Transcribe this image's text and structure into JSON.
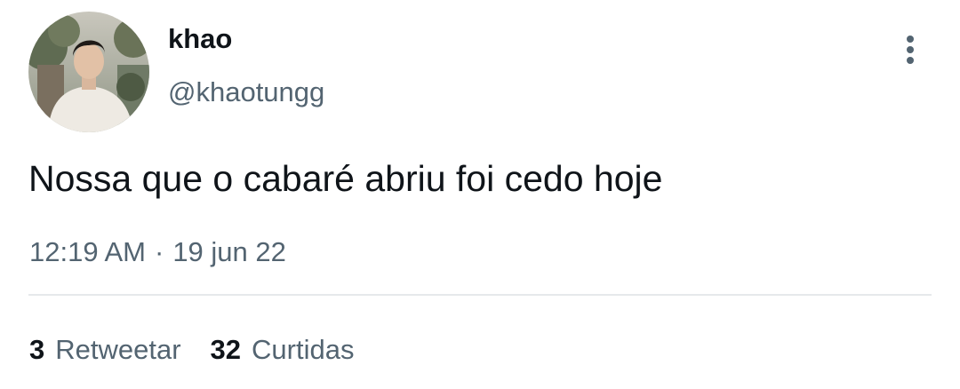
{
  "tweet": {
    "author": {
      "display_name": "khao",
      "handle": "@khaotungg"
    },
    "text": "Nossa que o cabaré abriu foi cedo hoje",
    "time": "12:19 AM",
    "separator": "·",
    "date": "19 jun 22",
    "stats": {
      "retweets_count": "3",
      "retweets_label": "Retweetar",
      "likes_count": "32",
      "likes_label": "Curtidas"
    }
  },
  "icons": {
    "more": "more-vertical-icon"
  },
  "colors": {
    "primary_text": "#0f1419",
    "secondary_text": "#536471",
    "divider": "#e6e9eb",
    "background": "#ffffff"
  }
}
